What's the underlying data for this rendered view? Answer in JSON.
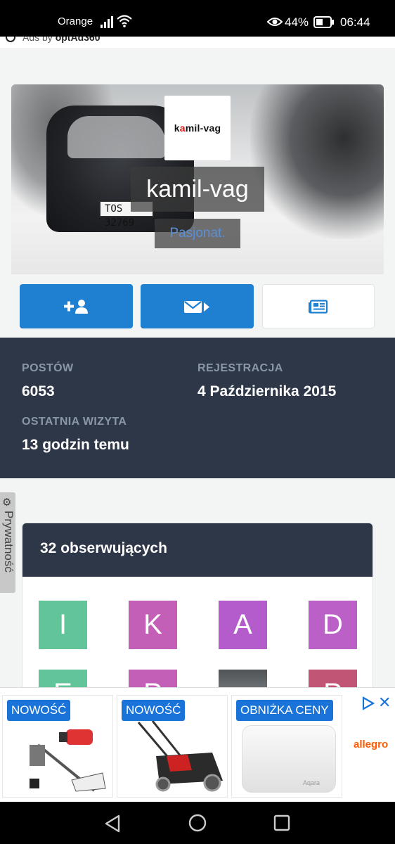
{
  "status_bar": {
    "carrier": "Orange",
    "battery": "44%",
    "time": "06:44"
  },
  "ads_by": {
    "prefix": "Ads by",
    "brand": "optAd360"
  },
  "profile": {
    "avatar_text_a": "k",
    "avatar_text_red": "a",
    "avatar_text_b": "mil-vag",
    "username": "kamil-vag",
    "rank": "Pasjonat.",
    "plate": "TOS 32769"
  },
  "actions": [
    {
      "icon": "add-user-icon"
    },
    {
      "icon": "send-message-icon"
    },
    {
      "icon": "newspaper-icon"
    }
  ],
  "stats": {
    "posts_label": "POSTÓW",
    "posts_value": "6053",
    "registered_label": "REJESTRACJA",
    "registered_value": "4 Października 2015",
    "last_visit_label": "OSTATNIA WIZYTA",
    "last_visit_value": "13 godzin temu"
  },
  "privacy": {
    "label": "Prywatność"
  },
  "followers": {
    "title": "32 obserwujących",
    "tiles": [
      {
        "letter": "I",
        "color": "#62c59a"
      },
      {
        "letter": "K",
        "color": "#c45fb7"
      },
      {
        "letter": "A",
        "color": "#b45ccc"
      },
      {
        "letter": "D",
        "color": "#bb60c6"
      },
      {
        "letter": "E",
        "color": "#62c59a"
      },
      {
        "letter": "P",
        "color": "#c45fb7"
      },
      {
        "letter": "",
        "color": "#7d8185"
      },
      {
        "letter": "P",
        "color": "#c05575"
      }
    ]
  },
  "ad": {
    "badges": [
      "NOWOŚĆ",
      "NOWOŚĆ",
      "OBNIŻKA CENY"
    ],
    "brand": "allegro",
    "product_text": "Aqara"
  },
  "colors": {
    "primary": "#1f7fd0",
    "dark_panel": "#2e3748"
  }
}
